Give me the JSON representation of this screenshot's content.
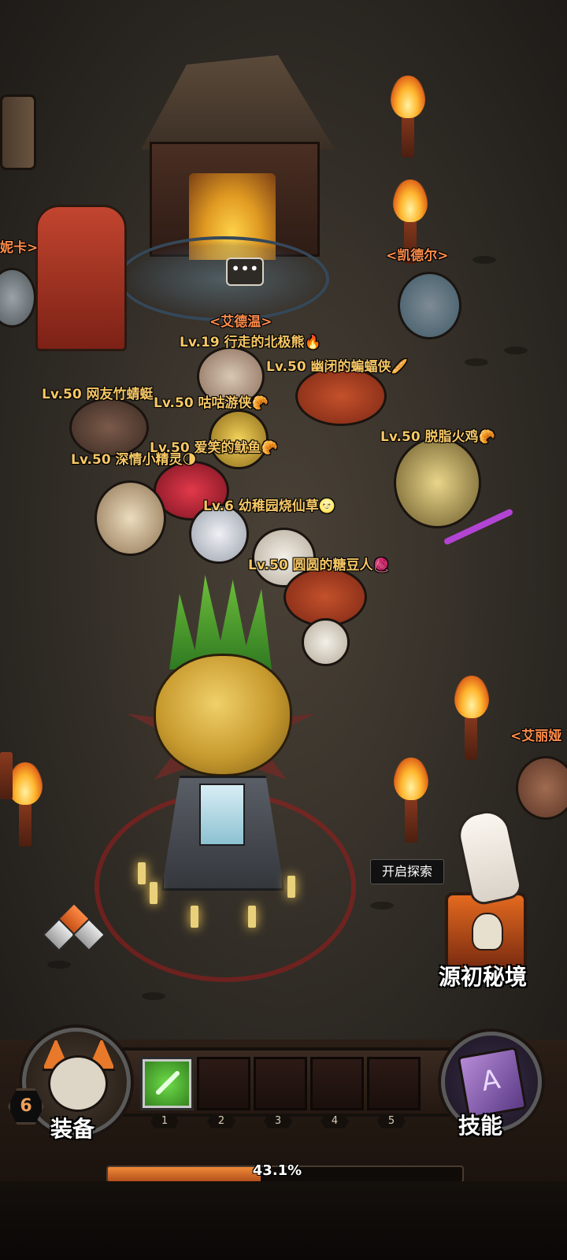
{
  "scene": {
    "npc_labels": {
      "nika": "妮卡>",
      "kaideer": "<凯德尔>",
      "aidewen": "<艾德温>",
      "aili": "<艾丽娅"
    },
    "players": [
      {
        "label": "Lv.19 行走的北极熊🔥"
      },
      {
        "label": "Lv.50 幽闭的蝙蝠侠🥖"
      },
      {
        "label": "Lv.50 网友竹蜻蜓"
      },
      {
        "label": "Lv.50 咕咕游侠🥐"
      },
      {
        "label": "Lv.50 脱脂火鸡🥐"
      },
      {
        "label": "Lv.50 爱笑的鱿鱼🥐"
      },
      {
        "label": "Lv.50 深情小精灵🌗"
      },
      {
        "label": "Lv.6 幼稚园烧仙草🌝"
      },
      {
        "label": "Lv.50 圆圆的糖豆人🧶"
      }
    ],
    "speech_bubble": "•••",
    "tooltip": "开启探索",
    "secret_realm_label": "源初秘境"
  },
  "hud": {
    "player_level": "6",
    "equip_label": "装备",
    "skill_label": "技能",
    "slots": [
      {
        "number": "1",
        "filled": true,
        "icon": "green-spear-skill-icon"
      },
      {
        "number": "2",
        "filled": false
      },
      {
        "number": "3",
        "filled": false
      },
      {
        "number": "4",
        "filled": false
      },
      {
        "number": "5",
        "filled": false
      }
    ],
    "xp_percent_text": "43.1%",
    "xp_fraction": 0.431
  },
  "colors": {
    "name_tag": "#f6c765",
    "npc_tag": "#ff8c4a",
    "xp_fill": "#f08a38",
    "accent_orange": "#e46a1f"
  }
}
